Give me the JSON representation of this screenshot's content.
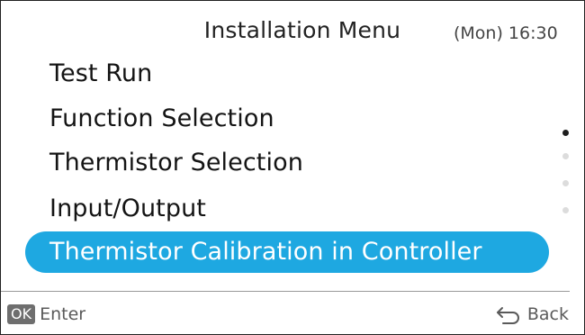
{
  "header": {
    "title": "Installation Menu",
    "clock": "(Mon) 16:30"
  },
  "menu": {
    "items": [
      {
        "label": "Test Run"
      },
      {
        "label": "Function Selection"
      },
      {
        "label": "Thermistor Selection"
      },
      {
        "label": "Input/Output"
      },
      {
        "label": "Thermistor Calibration in Controller",
        "selected": true
      }
    ]
  },
  "scroll": {
    "page_count": 4,
    "current_page": 1
  },
  "footer": {
    "ok_badge": "OK",
    "enter_label": "Enter",
    "back_label": "Back",
    "back_icon": "back-arrow-icon"
  },
  "colors": {
    "selection": "#1ea8e1",
    "text": "#141414",
    "muted": "#5a5a5a"
  }
}
